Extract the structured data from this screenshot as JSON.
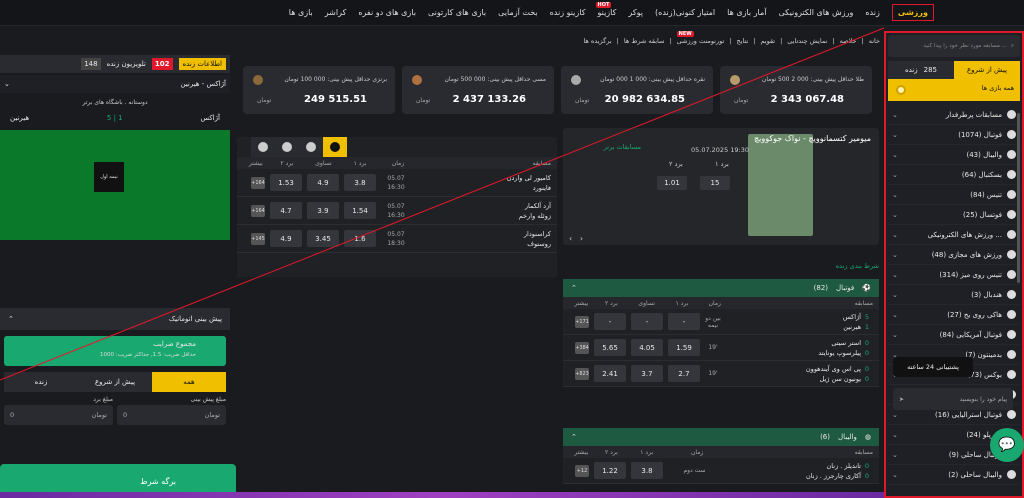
{
  "topnav": [
    "ورزشی",
    "زنده",
    "ورزش های الکترونیکی",
    "آمار بازی ها",
    "امتیاز کنونی(زنده)",
    "پوکر",
    "کازینو",
    "کازینو زنده",
    "بخت آزمایی",
    "بازی های کارتونی",
    "بازی های دو نفره",
    "کراشر",
    "بازی ها"
  ],
  "hot_label": "HOT",
  "new_label": "NEW",
  "subnav": [
    "خانه",
    "خلاصه",
    "نمایش چندتایی",
    "تقویم",
    "نتایج",
    "تورنومنت ورزشی",
    "سابقه شرط ها",
    "برگزیده ها"
  ],
  "search": {
    "placeholder": "مسابقه مورد نظر خود را پیدا کنید ..."
  },
  "tabs": {
    "prematch": "پیش از شروع",
    "live": "زنده",
    "live_count": "285"
  },
  "allgames": "همه بازی ها",
  "sports": [
    {
      "name": "مسابقات پرطرفدار"
    },
    {
      "name": "فوتبال (1074)"
    },
    {
      "name": "والیبال (43)"
    },
    {
      "name": "بسکتبال (64)"
    },
    {
      "name": "تنیس (84)"
    },
    {
      "name": "فوتسال (25)"
    },
    {
      "name": "ورزش های الکترونیکی ..."
    },
    {
      "name": "ورزش های مجازی (48)"
    },
    {
      "name": "تنیس روی میز (314)"
    },
    {
      "name": "هندبال (3)"
    },
    {
      "name": "هاکی روی یخ (27)"
    },
    {
      "name": "فوتبال آمریکایی (84)"
    },
    {
      "name": "بدمینتون (7)"
    },
    {
      "name": "بوکس (73)"
    },
    {
      "name": "..."
    },
    {
      "name": "فوتبال استرالیایی (16)"
    },
    {
      "name": "واترپلو (24)"
    },
    {
      "name": "فوتبال ساحلی (9)"
    },
    {
      "name": "والیبال ساحلی (2)"
    }
  ],
  "chat": {
    "support": "پشتیبانی 24 ساعته",
    "placeholder": "پیام خود را بنویسید"
  },
  "jackpots": [
    {
      "title": "طلا حداقل پیش بینی: 000 2 500 تومان",
      "amount": "2 343 067.48",
      "currency": "تومان"
    },
    {
      "title": "نقره حداقل پیش بینی: 000 1 000 تومان",
      "amount": "20 982 634.85",
      "currency": "تومان"
    },
    {
      "title": "مسی حداقل پیش بینی: 000 500 تومان",
      "amount": "2 437 133.26",
      "currency": "تومان"
    },
    {
      "title": "برنزی حداقل پیش بینی: 000 100 تومان",
      "amount": "249 515.51",
      "currency": "تومان"
    }
  ],
  "featured": {
    "title": "میومیر کتسمانوویچ - نواک جوکوویچ",
    "date": "05.07.2025 19:30",
    "h1": "برد ۱",
    "h2": "برد ۲",
    "o1": "15",
    "o2": "1.01"
  },
  "top_matches": {
    "title": "مسابقات برتر",
    "cols": [
      "مسابقه",
      "زمان",
      "برد ۱",
      "تساوی",
      "برد ۲",
      "بیشتر"
    ],
    "rows": [
      {
        "teams": "کامبور لی واردن\nفاینورد",
        "date": "05.07",
        "time": "16:30",
        "o1": "3.8",
        "x": "4.9",
        "o2": "1.53",
        "more": "+164"
      },
      {
        "teams": "آزد آلکمار\nزوئله وارخم",
        "date": "05.07",
        "time": "16:30",
        "o1": "1.54",
        "x": "3.9",
        "o2": "4.7",
        "more": "+164"
      },
      {
        "teams": "کراسنودار\nروستوف",
        "date": "05.07",
        "time": "18:30",
        "o1": "1.6",
        "x": "3.45",
        "o2": "4.9",
        "more": "+145"
      }
    ]
  },
  "live_title": "شرط بندی زنده",
  "football": {
    "title": "فوتبال",
    "count": "(82)",
    "cols": [
      "مسابقه",
      "زمان",
      "برد ۱",
      "تساوی",
      "برد ۲",
      "بیشتر"
    ],
    "rows": [
      {
        "t1": "آژاکس",
        "t2": "هیرنین",
        "s1": "5",
        "s2": "1",
        "time": "بین دو نیمه",
        "o1": "-",
        "x": "-",
        "o2": "-",
        "more": "+171"
      },
      {
        "t1": "استر سیتی",
        "t2": "پیلرسوپ یونایتد",
        "s1": "0",
        "s2": "0",
        "time": "19'",
        "o1": "1.59",
        "x": "4.05",
        "o2": "5.65",
        "more": "+384"
      },
      {
        "t1": "پی اس وی آیندهوون",
        "t2": "یونیون سن ژیل",
        "s1": "0",
        "s2": "0",
        "time": "19'",
        "o1": "2.7",
        "x": "3.7",
        "o2": "2.41",
        "more": "+823"
      }
    ]
  },
  "volleyball": {
    "title": "والیبال",
    "count": "(6)",
    "cols": [
      "مسابقه",
      "زمان",
      "برد ۱",
      "برد ۲",
      "بیشتر"
    ],
    "rows": [
      {
        "t1": "تاندیلز . زنان",
        "t2": "آکاری چارجرز . زنان",
        "s1": "0",
        "s2": "0",
        "time": "ست دوم",
        "o1": "3.8",
        "o2": "1.22",
        "more": "+12"
      }
    ]
  },
  "left": {
    "live_info": "اطلاعات زنده",
    "live_num": "102",
    "tv": "تلویزیون زنده",
    "tv_num": "148",
    "match": "آژاکس - هیرنین",
    "league": "دوستانه . باشگاه های برتر",
    "team1": "آژاکس",
    "team2": "هیرنین",
    "score1": "5",
    "score2": "1",
    "halftime": "نیمه اول",
    "auto": "پیش بینی اتوماتیک",
    "sum": "مجموع ضرایب",
    "minodds": "حداقل ضریب: 1.5, حداکثر ضریب: 1000",
    "seg": [
      "همه",
      "پیش از شروع",
      "زنده"
    ],
    "stake": "مبلغ پیش بینی",
    "win": "مبلغ برد",
    "zero": "0",
    "cur": "تومان",
    "slip": "برگه شرط"
  }
}
